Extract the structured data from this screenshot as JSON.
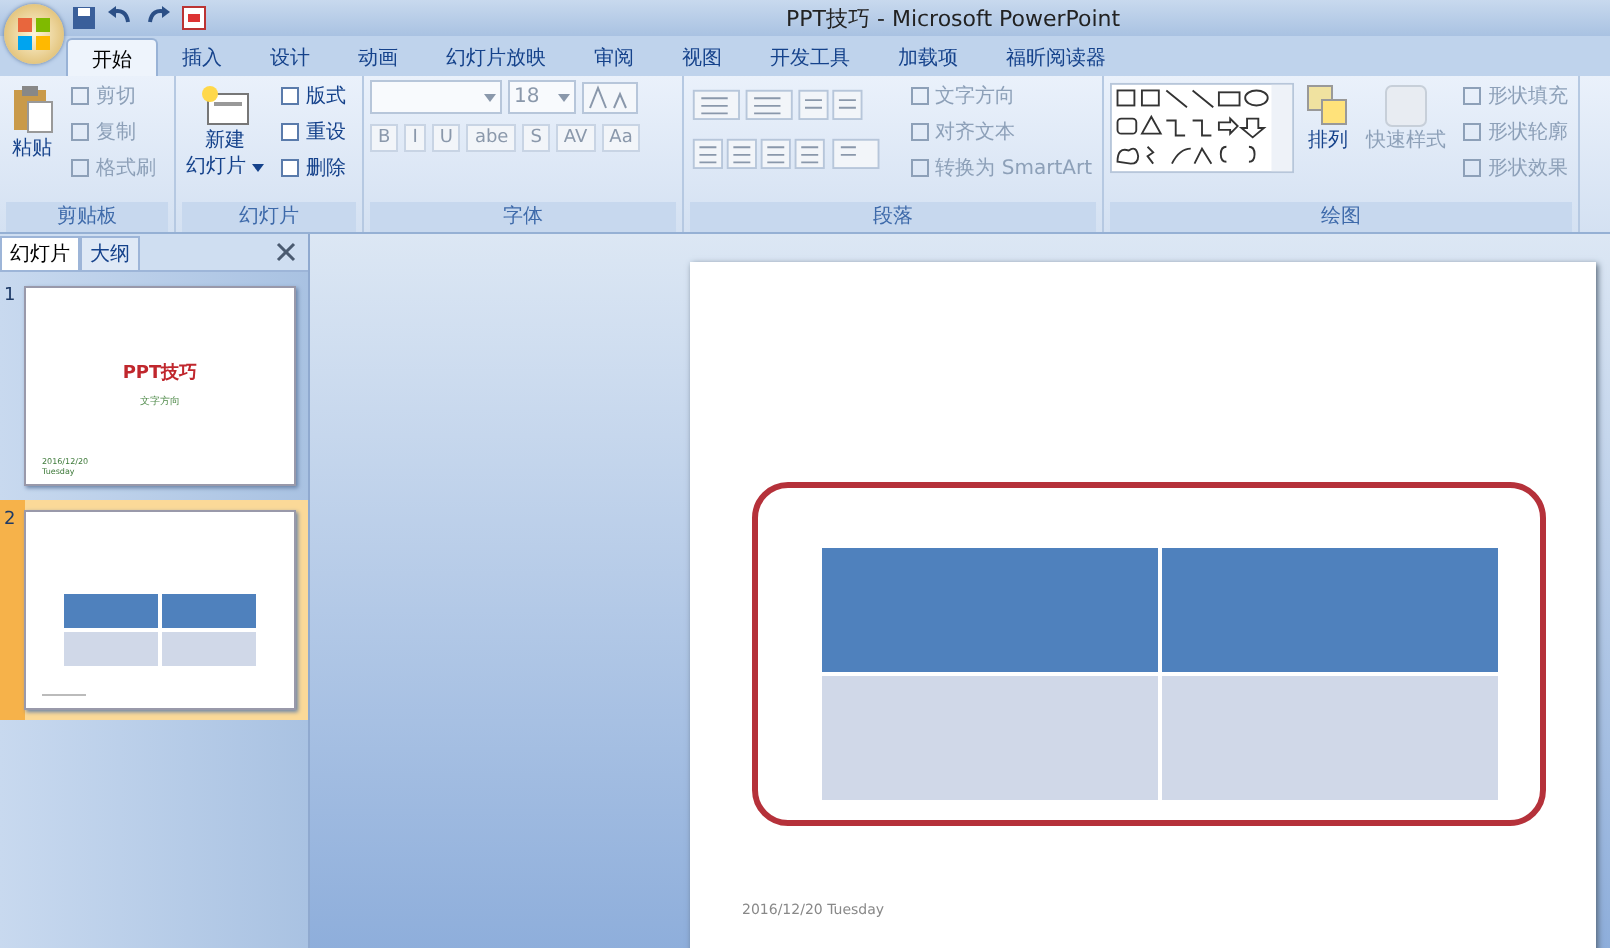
{
  "window": {
    "title": "PPT技巧 - Microsoft PowerPoint"
  },
  "tabs": [
    {
      "label": "开始",
      "selected": true
    },
    {
      "label": "插入",
      "selected": false
    },
    {
      "label": "设计",
      "selected": false
    },
    {
      "label": "动画",
      "selected": false
    },
    {
      "label": "幻灯片放映",
      "selected": false
    },
    {
      "label": "审阅",
      "selected": false
    },
    {
      "label": "视图",
      "selected": false
    },
    {
      "label": "开发工具",
      "selected": false
    },
    {
      "label": "加载项",
      "selected": false
    },
    {
      "label": "福昕阅读器",
      "selected": false
    }
  ],
  "clipboard": {
    "label": "剪贴板",
    "paste": "粘贴",
    "items": [
      {
        "label": "剪切",
        "disabled": true
      },
      {
        "label": "复制",
        "disabled": true
      },
      {
        "label": "格式刷",
        "disabled": true
      }
    ]
  },
  "slides_group": {
    "label": "幻灯片",
    "new_slide": [
      "新建",
      "幻灯片"
    ],
    "items": [
      {
        "label": "版式",
        "disabled": false
      },
      {
        "label": "重设",
        "disabled": false
      },
      {
        "label": "删除",
        "disabled": false
      }
    ]
  },
  "font": {
    "label": "字体",
    "size": "18",
    "buttons": [
      "B",
      "I",
      "U",
      "abe",
      "S",
      "AV",
      "Aa"
    ]
  },
  "paragraph": {
    "label": "段落",
    "items": [
      {
        "label": "文字方向",
        "disabled": true
      },
      {
        "label": "对齐文本",
        "disabled": true
      },
      {
        "label": "转换为 SmartArt",
        "disabled": true
      }
    ]
  },
  "drawing": {
    "label": "绘图",
    "arrange": "排列",
    "quick_styles": "快速样式",
    "items": [
      {
        "label": "形状填充",
        "disabled": true
      },
      {
        "label": "形状轮廓",
        "disabled": true
      },
      {
        "label": "形状效果",
        "disabled": true
      }
    ]
  },
  "pane_tabs": [
    {
      "label": "幻灯片",
      "selected": true
    },
    {
      "label": "大纲",
      "selected": false
    }
  ],
  "thumbnails": [
    {
      "number": "1",
      "selected": false,
      "kind": "title",
      "title": "PPT技巧",
      "subtitle": "文字方向",
      "date": [
        "2016/12/20",
        "Tuesday"
      ]
    },
    {
      "number": "2",
      "selected": true,
      "kind": "table"
    }
  ],
  "slide": {
    "date": "2016/12/20 Tuesday",
    "highlighted": true
  }
}
